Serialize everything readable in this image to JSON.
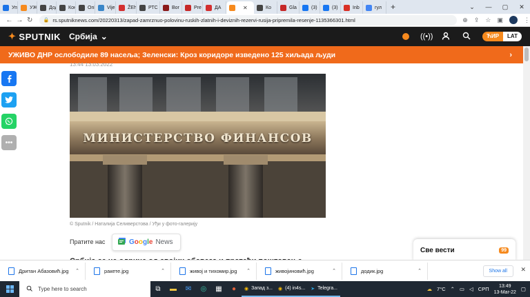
{
  "browser": {
    "tabs": [
      {
        "label": "Упр",
        "color": "#1a73e8"
      },
      {
        "label": "УЖ",
        "color": "#f68a1e"
      },
      {
        "label": "Дод",
        "color": "#444444"
      },
      {
        "label": "Кон",
        "color": "#444444"
      },
      {
        "label": "Onl",
        "color": "#444444"
      },
      {
        "label": "Vije",
        "color": "#3a86c8"
      },
      {
        "label": "ŽEh",
        "color": "#d32f2f"
      },
      {
        "label": "РТС",
        "color": "#444444"
      },
      {
        "label": "Bor",
        "color": "#8b1a1a"
      },
      {
        "label": "Pre",
        "color": "#c62828"
      },
      {
        "label": "ДА",
        "color": "#d32f2f"
      },
      {
        "label": "",
        "color": "#f68a1e",
        "active": true
      },
      {
        "label": "Ко",
        "color": "#444444"
      },
      {
        "label": "Gla",
        "color": "#c62828"
      },
      {
        "label": "(3)",
        "color": "#1877f2"
      },
      {
        "label": "(3)",
        "color": "#1877f2"
      },
      {
        "label": "Inb",
        "color": "#d93025"
      },
      {
        "label": "гул",
        "color": "#4285f4"
      }
    ],
    "new_tab": "+",
    "window_controls": [
      "⌄",
      "—",
      "▢",
      "✕"
    ],
    "url": "rs.sputniknews.com/20220313/zapad-zamrznuo-polovinu-ruskih-zlatnih-i-deviznih-rezervi-rusija-pripremila-resenje-1135366301.html"
  },
  "site": {
    "logo": "SPUTNIK",
    "region": "Србија",
    "script_toggle": {
      "active": "ЋИР",
      "inactive": "LAT"
    },
    "accent": "#f68a1e"
  },
  "banner": {
    "text": "УЖИВО ДНР ослободиле 89 насеља; Зеленски: Кроз коридоре изведено 125 хиљада људи",
    "color": "#f06a1b"
  },
  "share": [
    {
      "name": "facebook",
      "glyph": "f",
      "color": "#1877f2"
    },
    {
      "name": "twitter",
      "glyph": "t",
      "color": "#1da1f2"
    },
    {
      "name": "whatsapp",
      "glyph": "w",
      "color": "#25d366"
    },
    {
      "name": "more",
      "glyph": "•••",
      "color": "#b0b0b0"
    }
  ],
  "article": {
    "timestamp": "13:44 13.03.2022",
    "photo_sign": "МИНИСТЕРСТВО ФИНАНСОВ",
    "caption": "© Sputnik / Наталија Селиверстова / Уђи у фото-галерију",
    "follow_label": "Пратите нас",
    "gnews_label": "News",
    "next_heading": "Србија се не одриче од својих обавеза и пратећи поштовање"
  },
  "all_news": {
    "label": "Све вести",
    "count": "99"
  },
  "downloads": {
    "items": [
      "Дритан Абазовић.jpg",
      "ракете.jpg",
      "живој и тихомир.jpg",
      "живојиновић.jpg",
      "додик.jpg"
    ],
    "show_all": "Show all"
  },
  "taskbar": {
    "search_placeholder": "Type here to search",
    "apps": [
      "Запад з...",
      "(4) in4s...",
      "Telegra..."
    ],
    "weather": "7°C",
    "lang": "СРП",
    "time": "13:49",
    "date": "13-Mar-22"
  }
}
